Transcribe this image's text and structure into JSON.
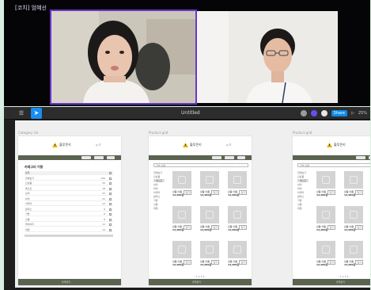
{
  "meeting": {
    "participant_label": "[코치] 엄혜선"
  },
  "app": {
    "menu_icon": "figma-menu-icon",
    "move_tool_icon": "cursor-icon",
    "file_title": "Untitled",
    "share_label": "Share",
    "present_label": "▷",
    "zoom_label": "25%",
    "avatar_colors": [
      "#9a9a9a",
      "#6c4cf0",
      "#e6e6e6"
    ]
  },
  "frames": [
    {
      "label": "Category list",
      "logo_text": "블루몬키",
      "header_icons": "◎ ☰",
      "section_title": "카테고리 이동",
      "rows": [
        {
          "label": "분류",
          "value": ""
        },
        {
          "label": "전체보기",
          "value": "120"
        },
        {
          "label": "신상품",
          "value": "25"
        },
        {
          "label": "베스트",
          "value": "18"
        },
        {
          "label": "상의",
          "value": "32"
        },
        {
          "label": "하의",
          "value": "21"
        },
        {
          "label": "아우터",
          "value": "12"
        },
        {
          "label": "원피스",
          "value": "9"
        },
        {
          "label": "가방",
          "value": "6"
        },
        {
          "label": "신발",
          "value": "8"
        },
        {
          "label": "액세서리",
          "value": "11"
        },
        {
          "label": "세일",
          "value": "14"
        }
      ],
      "footer": "블루몬키"
    },
    {
      "label": "Product grid",
      "logo_text": "블루몬키",
      "header_icons": "◎ ☰",
      "filter": "전체 상품",
      "categories": [
        "전체보기",
        "신상품",
        "베스트",
        "상의",
        "하의",
        "아우터",
        "원피스",
        "가방",
        "신발",
        "세일"
      ],
      "card_name": "상품 이름",
      "card_price": "12,000원",
      "card_btn": "담기",
      "pager": "‹ 1 2 3 4 ›",
      "footer": "블루몬키"
    },
    {
      "label": "Product grid",
      "logo_text": "블루몬키",
      "header_icons": "◎ ☰",
      "filter": "전체 상품",
      "categories": [
        "전체보기",
        "신상품",
        "베스트",
        "상의",
        "하의",
        "아우터",
        "원피스",
        "가방",
        "신발",
        "세일"
      ],
      "card_name": "상품 이름",
      "card_price": "12,000원",
      "card_btn": "담기",
      "pager": "‹ 1 2 3 4 ›",
      "footer": "블루몬키"
    }
  ]
}
